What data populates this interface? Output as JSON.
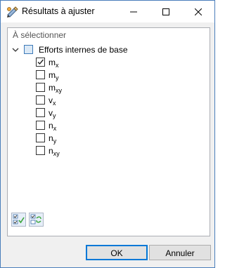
{
  "window": {
    "title": "Résultats à ajuster"
  },
  "section": {
    "label": "À sélectionner"
  },
  "tree": {
    "parent_label": "Efforts internes de base",
    "items": [
      {
        "base": "m",
        "sub": "x",
        "checked": true
      },
      {
        "base": "m",
        "sub": "y",
        "checked": false
      },
      {
        "base": "m",
        "sub": "xy",
        "checked": false
      },
      {
        "base": "v",
        "sub": "x",
        "checked": false
      },
      {
        "base": "v",
        "sub": "y",
        "checked": false
      },
      {
        "base": "n",
        "sub": "x",
        "checked": false
      },
      {
        "base": "n",
        "sub": "y",
        "checked": false
      },
      {
        "base": "n",
        "sub": "xy",
        "checked": false
      }
    ]
  },
  "buttons": {
    "ok": "OK",
    "cancel": "Annuler"
  },
  "icons": {
    "app": "pencil-ruler-icon",
    "select_all": "select-all-icon",
    "invert": "invert-selection-icon"
  }
}
